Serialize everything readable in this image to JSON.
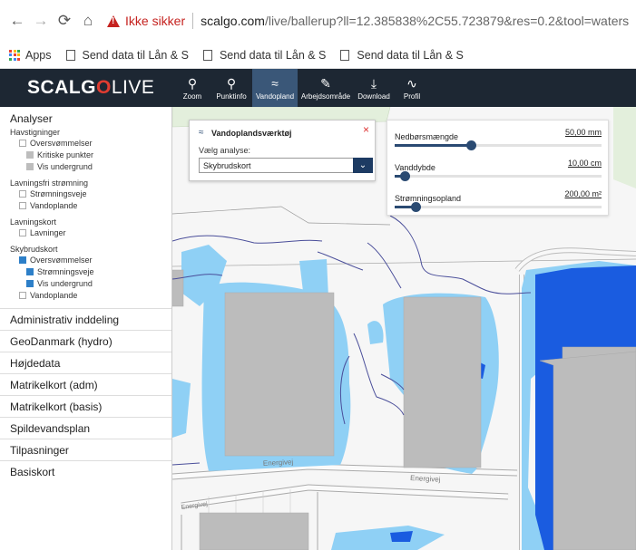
{
  "browser": {
    "security_label": "Ikke sikker",
    "url_host": "scalgo.com",
    "url_path": "/live/ballerup?ll=12.385838%2C55.723879&res=0.2&tool=waters"
  },
  "bookmarks": {
    "apps_label": "Apps",
    "items": [
      "Send data til Lån & S",
      "Send data til Lån & S",
      "Send data til Lån & S"
    ]
  },
  "app": {
    "logo_scal": "SCALG",
    "logo_o": "O",
    "logo_live": "LIVE",
    "tools": [
      {
        "label": "Zoom",
        "icon": "search-icon"
      },
      {
        "label": "Punktinfo",
        "icon": "map-pin-icon"
      },
      {
        "label": "Vandopland",
        "icon": "water-icon"
      },
      {
        "label": "Arbejdsområde",
        "icon": "pencil-icon"
      },
      {
        "label": "Download",
        "icon": "download-icon"
      },
      {
        "label": "Profil",
        "icon": "profile-line-icon"
      }
    ],
    "active_tool": "Vandopland"
  },
  "sidebar": {
    "title": "Analyser",
    "groups": [
      {
        "title": "Havstigninger",
        "items": [
          {
            "label": "Oversvømmelser",
            "state": "off",
            "level": 1
          },
          {
            "label": "Kritiske punkter",
            "state": "grey",
            "level": 2
          },
          {
            "label": "Vis undergrund",
            "state": "grey",
            "level": 2
          }
        ]
      },
      {
        "title": "Lavningsfri strømning",
        "items": [
          {
            "label": "Strømningsveje",
            "state": "off",
            "level": 1
          },
          {
            "label": "Vandoplande",
            "state": "off",
            "level": 1
          }
        ]
      },
      {
        "title": "Lavningskort",
        "items": [
          {
            "label": "Lavninger",
            "state": "off",
            "level": 1
          }
        ]
      },
      {
        "title": "Skybrudskort",
        "items": [
          {
            "label": "Oversvømmelser",
            "state": "on",
            "level": 1
          },
          {
            "label": "Strømningsveje",
            "state": "on",
            "level": 2
          },
          {
            "label": "Vis undergrund",
            "state": "on",
            "level": 2
          },
          {
            "label": "Vandoplande",
            "state": "off",
            "level": 1
          }
        ]
      }
    ],
    "sections": [
      "Administrativ inddeling",
      "GeoDanmark (hydro)",
      "Højdedata",
      "Matrikelkort (adm)",
      "Matrikelkort (basis)",
      "Spildevandsplan",
      "Tilpasninger",
      "Basiskort"
    ]
  },
  "vandopland_panel": {
    "title": "Vandoplandsværktøj",
    "close": "×",
    "select_label": "Vælg analyse:",
    "select_value": "Skybrudskort"
  },
  "sliders": [
    {
      "label": "Nedbørsmængde",
      "value": "50,00 mm",
      "fraction": 0.37
    },
    {
      "label": "Vanddybde",
      "value": "10,00 cm",
      "fraction": 0.05
    },
    {
      "label": "Strømningsopland",
      "value": "200,00 m²",
      "fraction": 0.1
    }
  ],
  "map": {
    "road_labels": [
      "Energivej",
      "Energivej",
      "Energivej"
    ],
    "colors": {
      "shallow_water": "#8fd0f5",
      "deep_water": "#1a5ce0",
      "building": "#bcbcbc",
      "stream": "#4a4e9a"
    }
  }
}
